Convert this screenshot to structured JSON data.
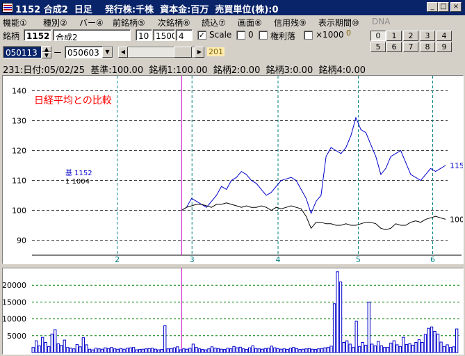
{
  "window": {
    "title": "1152 合成2  日足    発行株:千株  資本金:百万  売買単位(株):0",
    "minimize": "_",
    "maximize": "□",
    "close": "×"
  },
  "menu": [
    "機能①",
    "種別②",
    "バー④",
    "前銘柄⑤",
    "次銘柄⑥",
    "読込⑦",
    "画面⑧",
    "信用残⑨",
    "表示期間⑩",
    "DNA"
  ],
  "toolbar": {
    "code_label": "銘柄",
    "code": "1152",
    "name": "合成2",
    "param1": "10",
    "param2": "1500",
    "param3": "4",
    "scale_label": "Scale",
    "scale_checked": true,
    "zero_label": "0",
    "zero_checked": false,
    "rights_label": "権利落",
    "rights_checked": false,
    "x1000_label": "×1000",
    "x1000_value": "0",
    "num_buttons": [
      "0",
      "1",
      "2",
      "3",
      "4",
      "5",
      "6",
      "7",
      "8",
      "9"
    ],
    "active_num": "0",
    "start_date": "050113",
    "dash": "ー",
    "end_date": "050603",
    "count": "201"
  },
  "info": {
    "text": "231:日付:05/02/25  基準:100.00  銘柄1:100.00  銘柄2:0.00  銘柄3:0.00  銘柄4:0.00"
  },
  "chart_data": [
    {
      "type": "line",
      "annotation": "日経平均との比較",
      "annotation_color": "#ff0000",
      "ylim": [
        85,
        145
      ],
      "yticks": [
        90,
        100,
        110,
        120,
        130,
        140
      ],
      "xticks": [
        {
          "label": "2",
          "pos": 0.205
        },
        {
          "label": "3",
          "pos": 0.385
        },
        {
          "label": "4",
          "pos": 0.592
        },
        {
          "label": "5",
          "pos": 0.785
        },
        {
          "label": "6",
          "pos": 0.964
        }
      ],
      "cursor_pos": 0.36,
      "legend": [
        {
          "label": "基 1152",
          "color": "#0000cc"
        },
        {
          "label": "1 1004",
          "color": "#000000"
        }
      ],
      "series": [
        {
          "name": "1152",
          "color": "#0000cc",
          "end_label": "115",
          "values": [
            100,
            101,
            104,
            103,
            102,
            101,
            103,
            105,
            108,
            107,
            110,
            111,
            113,
            112,
            110,
            109,
            107,
            105,
            106,
            108,
            110,
            110.5,
            111,
            110,
            107,
            104,
            99,
            103,
            105,
            118,
            121,
            120,
            119,
            121,
            125,
            131,
            127,
            126,
            122,
            118,
            112,
            114,
            118,
            119,
            120,
            116,
            112,
            111,
            110,
            112,
            114,
            113,
            114,
            115
          ]
        },
        {
          "name": "1004",
          "color": "#000000",
          "end_label": "100",
          "values": [
            100,
            101,
            101.5,
            102,
            102,
            101.5,
            101,
            102,
            102,
            102.5,
            102,
            101.5,
            101,
            101.5,
            101,
            101,
            101.5,
            101,
            100,
            101,
            100.5,
            101,
            101.5,
            101,
            100.5,
            98,
            94,
            96,
            96,
            95.5,
            95.5,
            95,
            95,
            95.5,
            95,
            95,
            95.5,
            96,
            96,
            95.5,
            94,
            93.5,
            94,
            95.5,
            95,
            95,
            96,
            96.5,
            96,
            97,
            97.5,
            98,
            97.5,
            97
          ]
        }
      ]
    },
    {
      "type": "bar",
      "ylim": [
        0,
        25000
      ],
      "yticks": [
        5000,
        10000,
        15000,
        20000
      ],
      "values": [
        1500,
        3500,
        2000,
        4500,
        3000,
        1800,
        5500,
        6800,
        2600,
        2100,
        3700,
        1500,
        1300,
        1100,
        2400,
        1700,
        4400,
        2300,
        1000,
        800,
        1300,
        1100,
        1000,
        1400,
        1200,
        1500,
        1100,
        1000,
        1200,
        1000,
        1300,
        1400,
        1500,
        800,
        900,
        1000,
        1100,
        1200,
        1300,
        1000,
        800,
        900,
        8000,
        1100,
        1200,
        1400,
        1700,
        800,
        1100,
        1000,
        1300,
        2500,
        1500,
        1100,
        900,
        800,
        1100,
        1700,
        1300,
        1200,
        1000,
        900,
        1300,
        1100,
        1800,
        1400,
        1600,
        1100,
        900,
        1400,
        2000,
        1200,
        1100,
        1000,
        1200,
        1300,
        1900,
        1400,
        1200,
        1000,
        1100,
        900,
        1300,
        1500,
        1200,
        900,
        1000,
        1100,
        1200,
        1000,
        900,
        1100,
        1200,
        1400,
        1500,
        1900,
        14500,
        24000,
        21000,
        3000,
        3500,
        2500,
        1500,
        9300,
        1800,
        3000,
        2200,
        15000,
        2500,
        2000,
        3300,
        2000,
        1500,
        1500,
        2800,
        3500,
        2300,
        1800,
        4500,
        2400,
        2600,
        2200,
        3000,
        3800,
        3000,
        5400,
        7200,
        7600,
        6300,
        5500,
        3100,
        1800,
        2300,
        1500,
        1700,
        7000
      ]
    }
  ]
}
